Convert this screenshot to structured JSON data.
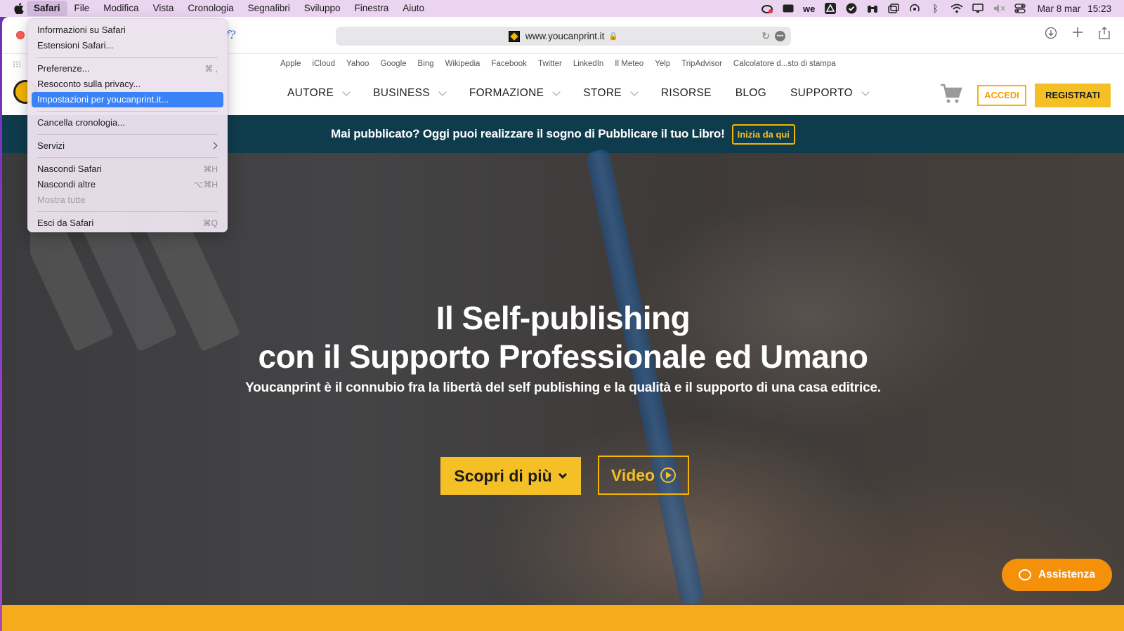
{
  "menubar": {
    "app": "Safari",
    "items": [
      "File",
      "Modifica",
      "Vista",
      "Cronologia",
      "Segnalibri",
      "Sviluppo",
      "Finestra",
      "Aiuto"
    ],
    "date": "Mar 8 mar",
    "time": "15:23"
  },
  "browser": {
    "faded_text": "f?",
    "url": "www.youcanprint.it",
    "favorites": [
      "Apple",
      "iCloud",
      "Yahoo",
      "Google",
      "Bing",
      "Wikipedia",
      "Facebook",
      "Twitter",
      "LinkedIn",
      "Il Meteo",
      "Yelp",
      "TripAdvisor",
      "Calcolatore d...sto di stampa"
    ]
  },
  "site": {
    "nav": [
      "AUTORE",
      "BUSINESS",
      "FORMAZIONE",
      "STORE",
      "RISORSE",
      "BLOG",
      "SUPPORTO"
    ],
    "login": "ACCEDI",
    "register": "REGISTRATI",
    "banner_text": "Mai pubblicato? Oggi puoi realizzare il sogno di Pubblicare il tuo Libro!",
    "banner_button": "Inizia da qui",
    "hero_title_1": "Il Self-publishing",
    "hero_title_2": "con il Supporto Professionale ed Umano",
    "hero_subtitle": "Youcanprint è il connubio fra la libertà del self publishing e la qualità e il supporto di una casa editrice.",
    "cta_primary": "Scopri di più",
    "cta_video": "Video",
    "assist": "Assistenza"
  },
  "dropdown": {
    "items": [
      {
        "label": "Informazioni su Safari",
        "shortcut": ""
      },
      {
        "label": "Estensioni Safari...",
        "shortcut": ""
      },
      {
        "label": "Preferenze...",
        "shortcut": "⌘ ,"
      },
      {
        "label": "Resoconto sulla privacy...",
        "shortcut": ""
      },
      {
        "label": "Impostazioni per youcanprint.it...",
        "shortcut": ""
      },
      {
        "label": "Cancella cronologia...",
        "shortcut": ""
      },
      {
        "label": "Servizi",
        "shortcut": ""
      },
      {
        "label": "Nascondi Safari",
        "shortcut": "⌘H"
      },
      {
        "label": "Nascondi altre",
        "shortcut": "⌥⌘H"
      },
      {
        "label": "Mostra tutte",
        "shortcut": ""
      },
      {
        "label": "Esci da Safari",
        "shortcut": "⌘Q"
      }
    ]
  },
  "colors": {
    "accent": "#f5c026",
    "banner": "#0f3c4d",
    "assist": "#f5900a",
    "selection": "#3a82f7"
  }
}
